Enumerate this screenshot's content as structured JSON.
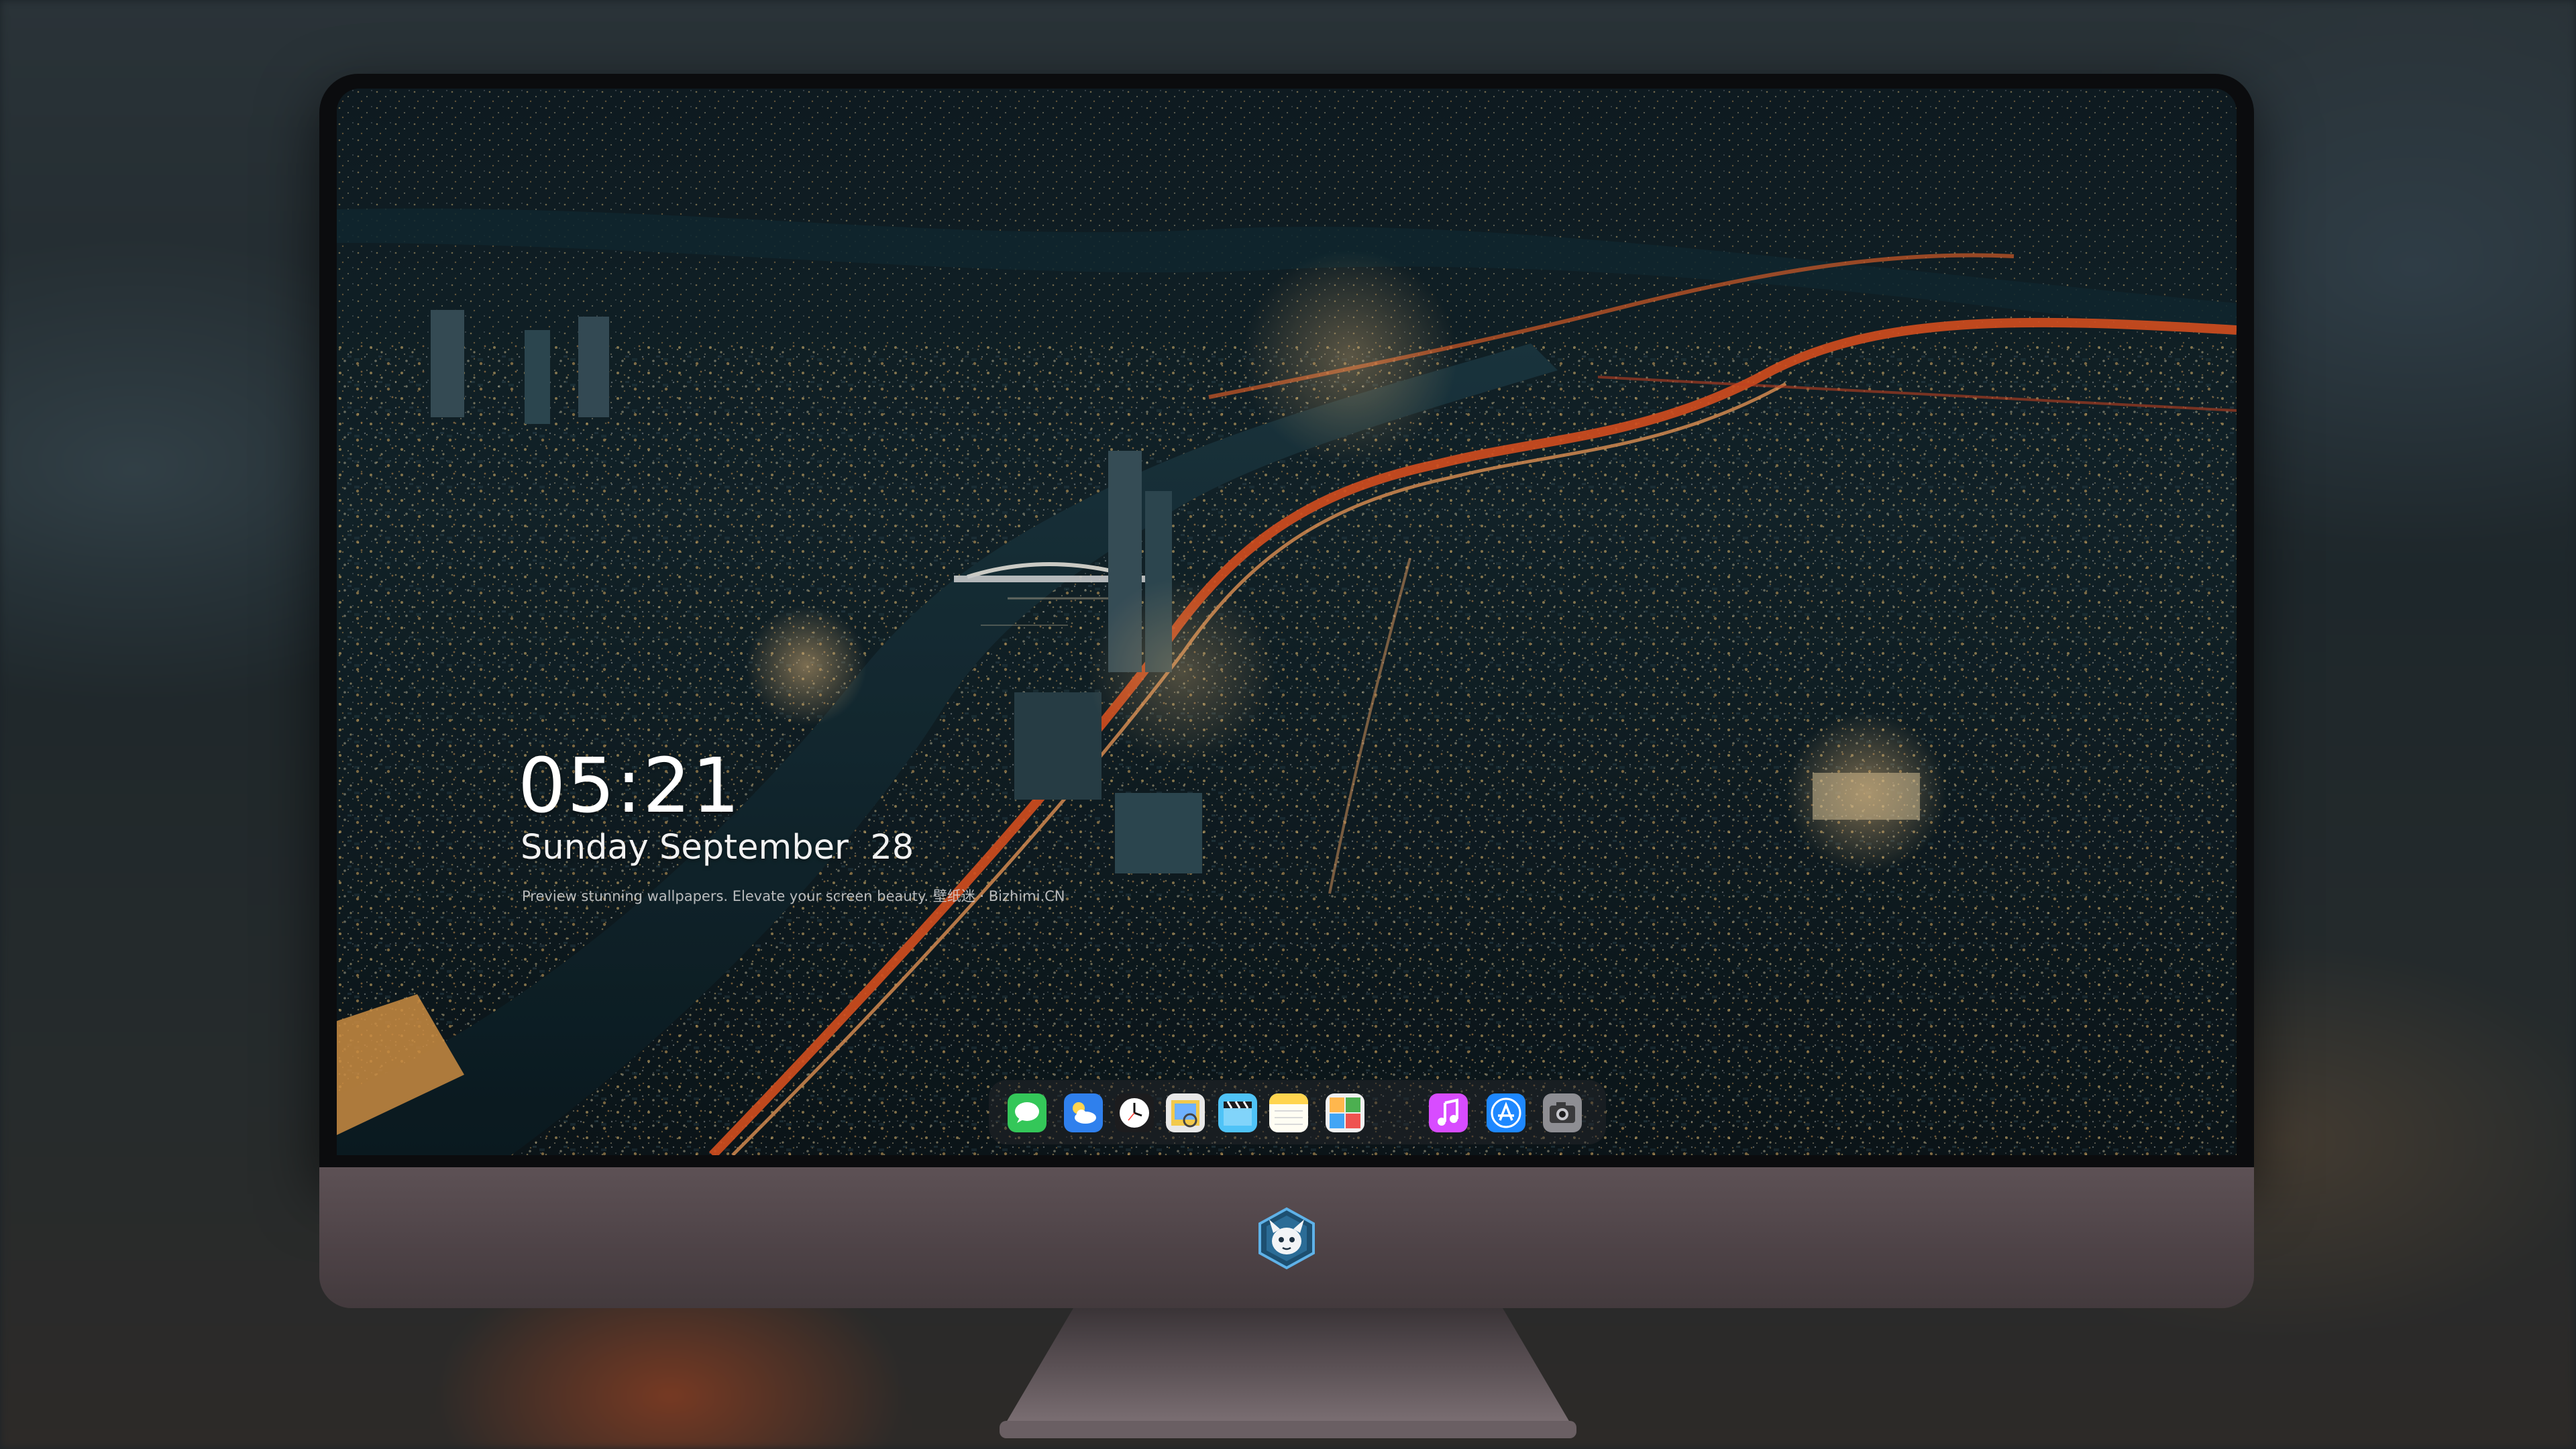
{
  "lock_screen": {
    "time": "05:21",
    "date": "Sunday September  28",
    "tagline": "Preview stunning wallpapers. Elevate your screen beauty. 壁纸迷 · Bizhimi.CN"
  },
  "dock": {
    "apps": [
      {
        "icon": "messages-icon",
        "color": "#34c759"
      },
      {
        "icon": "weather-icon",
        "color": "#3a8ef6"
      },
      {
        "icon": "clock-icon",
        "color": "#ffffff"
      },
      {
        "icon": "preview-icon",
        "color": "#f2c94c"
      },
      {
        "icon": "clips-icon",
        "color": "#4fc3f7"
      },
      {
        "icon": "notes-icon",
        "color": "#ffd54f"
      },
      {
        "icon": "photos-icon",
        "color": "#e0e0e0"
      },
      {
        "icon": "music-icon",
        "color": "#d84cff"
      },
      {
        "icon": "app-store-icon",
        "color": "#1e88ff"
      },
      {
        "icon": "camera-icon",
        "color": "#8e8e93"
      }
    ]
  },
  "colors": {
    "bezel": "#0b0c0e",
    "chin": "#4d4246",
    "stand": "#4a4245",
    "city_light": "#ffb347",
    "highway": "#ff5a1f"
  }
}
